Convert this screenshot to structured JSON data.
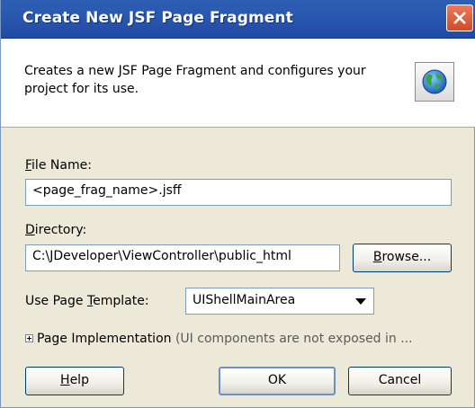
{
  "dialog": {
    "title": "Create New JSF Page Fragment",
    "description": "Creates a new JSF Page Fragment and configures your project for its use."
  },
  "form": {
    "file_name": {
      "label_key": "F",
      "label_rest": "ile Name:",
      "value": "<page_frag_name>.jsff"
    },
    "directory": {
      "label_key": "D",
      "label_rest": "irectory:",
      "value": "C:\\JDeveloper\\ViewController\\public_html"
    },
    "browse": {
      "label_key": "B",
      "label_rest": "rowse..."
    },
    "template": {
      "label_pre": "Use Page ",
      "label_key": "T",
      "label_rest": "emplate:",
      "selected": "UIShellMainArea"
    },
    "implementation": {
      "label": "Page Implementation",
      "note": "(UI components are not exposed in ..."
    }
  },
  "buttons": {
    "help": {
      "label_key": "H",
      "label_rest": "elp"
    },
    "ok": "OK",
    "cancel": "Cancel"
  },
  "colors": {
    "titlebar": "#2a58b0",
    "dialog_bg": "#ece9d8",
    "close_button": "#d24a22"
  },
  "icons": {
    "close": "close-icon",
    "header": "globe-icon",
    "dropdown": "chevron-down-icon",
    "expand": "plus-icon"
  }
}
